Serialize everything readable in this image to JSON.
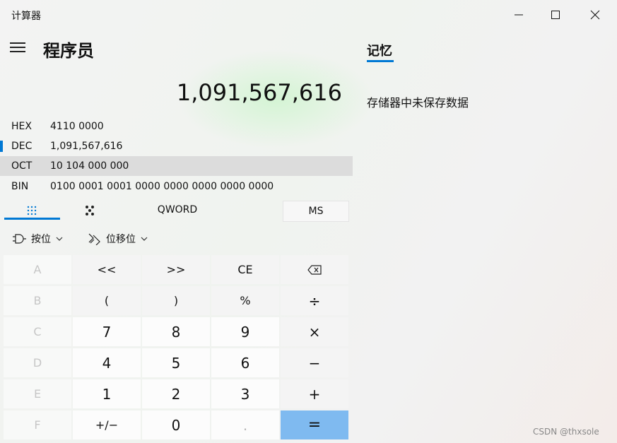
{
  "window": {
    "title": "计算器"
  },
  "header": {
    "mode_title": "程序员"
  },
  "display": {
    "value": "1,091,567,616"
  },
  "radix": [
    {
      "label": "HEX",
      "value": "4110 0000",
      "selected": false,
      "active": false
    },
    {
      "label": "DEC",
      "value": "1,091,567,616",
      "selected": false,
      "active": true
    },
    {
      "label": "OCT",
      "value": "10 104 000 000",
      "selected": true,
      "active": false
    },
    {
      "label": "BIN",
      "value": "0100 0001 0001 0000 0000 0000 0000 0000",
      "selected": false,
      "active": false
    }
  ],
  "tabs": {
    "word_size": "QWORD",
    "ms": "MS"
  },
  "bitops": {
    "bitwise": "按位",
    "bitshift": "位移位"
  },
  "keys": {
    "r0": [
      "A",
      "<<",
      ">>",
      "CE",
      "⌫"
    ],
    "r1": [
      "B",
      "(",
      ")",
      "%",
      "÷"
    ],
    "r2": [
      "C",
      "7",
      "8",
      "9",
      "×"
    ],
    "r3": [
      "D",
      "4",
      "5",
      "6",
      "−"
    ],
    "r4": [
      "E",
      "1",
      "2",
      "3",
      "+"
    ],
    "r5": [
      "F",
      "+/−",
      "0",
      ".",
      "="
    ]
  },
  "memory": {
    "title": "记忆",
    "empty_text": "存储器中未保存数据"
  },
  "watermark": "CSDN @thxsole",
  "colors": {
    "accent": "#0078d4",
    "equals": "#7fbaf0"
  }
}
